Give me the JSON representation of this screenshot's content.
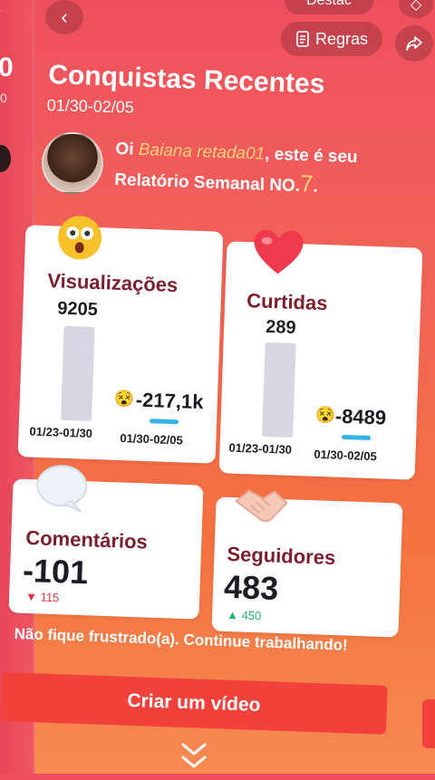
{
  "top": {
    "back_icon": "chevron-left-icon",
    "top_pill_label": "Destac",
    "rules_label": "Regras",
    "rules_icon": "document-icon",
    "share_icon": "share-icon"
  },
  "left_edge": {
    "value": "0",
    "sub": "0"
  },
  "header": {
    "title": "Conquistas Recentes",
    "date_range": "01/30-02/05"
  },
  "greeting": {
    "prefix": "Oi ",
    "username": "Baiana retada01",
    "middle": ", este é seu",
    "line2": "Relatório Semanal NO.",
    "report_number": "7",
    "suffix": "."
  },
  "cards": {
    "views": {
      "label": "Visualizações",
      "value": "9205",
      "delta": "-217,1k",
      "prev_period": "01/23-01/30",
      "curr_period": "01/30-02/05",
      "emoji": "shocked-face"
    },
    "likes": {
      "label": "Curtidas",
      "value": "289",
      "delta": "-8489",
      "prev_period": "01/23-01/30",
      "curr_period": "01/30-02/05",
      "emoji": "heart"
    },
    "comments": {
      "label": "Comentários",
      "value": "-101",
      "change": "115",
      "direction": "down",
      "emoji": "speech-bubble"
    },
    "followers": {
      "label": "Seguidores",
      "value": "483",
      "change": "450",
      "direction": "up",
      "emoji": "handshake"
    }
  },
  "motivation": "Não fique frustrado(a). Continue trabalhando!",
  "cta": {
    "label": "Criar um vídeo"
  },
  "colors": {
    "accent": "#f2413a",
    "label": "#7a1f2b",
    "up": "#24b36d",
    "down": "#e0353f",
    "bar_current": "#36b3e6",
    "bar_previous": "#d8d6e2",
    "username": "#ffd27a"
  }
}
